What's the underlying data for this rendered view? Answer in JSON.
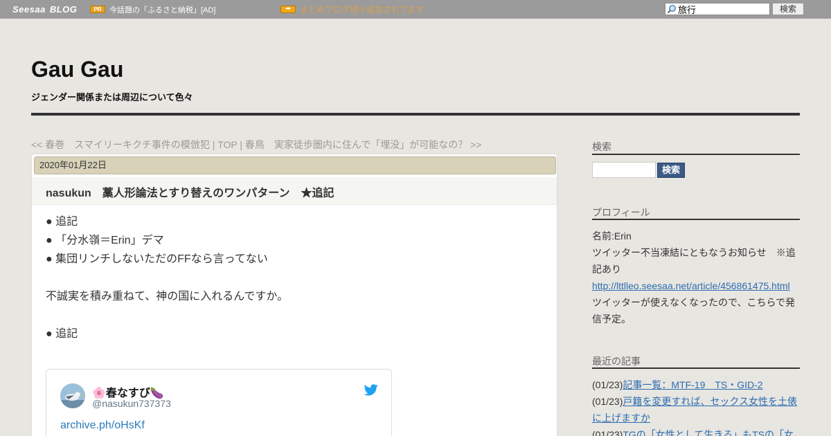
{
  "topbar": {
    "logo": "Seesaa",
    "logo_blog": "BLOG",
    "pr_badge": "PR",
    "pr_text": "今話題の「ふるさと納税」[AD]",
    "promo_link": "まとめブログ続々追加されてます",
    "search_value": "旅行",
    "search_button": "検索"
  },
  "header": {
    "title": "Gau Gau",
    "description": "ジェンダー関係または周辺について色々"
  },
  "article_nav": "<< 春巻　スマイリーキクチ事件の模倣犯 | TOP | 春鳥　実家徒歩圏内に住んで「埋没」が可能なの？ >>",
  "article": {
    "date": "2020年01月22日",
    "title": "nasukun　藁人形論法とすり替えのワンパターン　★追記",
    "lines": [
      "● 追記",
      "● 「分水嶺＝Erin」デマ",
      "● 集団リンチしないただのFFなら言ってない",
      "",
      "不誠実を積み重ねて、神の国に入れるんですか。",
      "",
      "● 追記"
    ],
    "tweet": {
      "name": "🌸春なすび🍆",
      "handle": "@nasukun737373",
      "link": "archive.ph/oHsKf"
    }
  },
  "sidebar": {
    "search_heading": "検索",
    "search_button": "検索",
    "profile_heading": "プロフィール",
    "profile_name": "名前:Erin",
    "profile_notice": "ツイッター不当凍結にともなうお知らせ　※追記あり",
    "profile_url": "http://lttlleo.seesaa.net/article/456861475.html",
    "profile_note": "ツイッターが使えなくなったので、こちらで発信予定。",
    "recent_heading": "最近の記事",
    "recent": [
      {
        "date": "(01/23)",
        "title": "記事一覧：MTF-19　TS・GID-2"
      },
      {
        "date": "(01/23)",
        "title": "戸籍を変更すれば、セックス女性を土俵に上げますか"
      },
      {
        "date": "(01/23)",
        "title": "TGの「女性として生きる」もTSの「女"
      }
    ]
  },
  "colors": {
    "topbar": "#9b9b9b",
    "background": "#e8e6e1",
    "date_bar": "#d8d2b9",
    "link": "#2b6cb0",
    "search_button": "#3c5a86"
  }
}
